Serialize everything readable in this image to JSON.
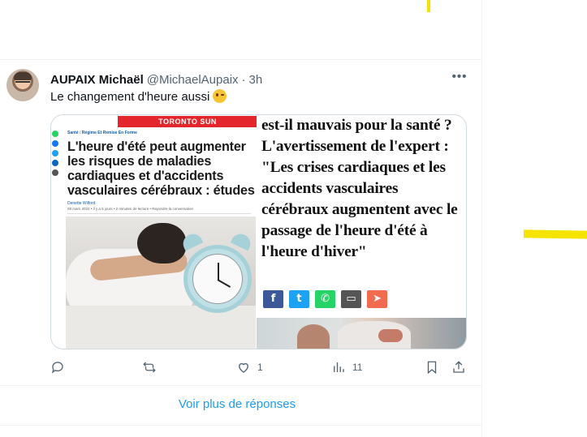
{
  "tweet": {
    "author_name": "AUPAIX Michaël",
    "handle": "@MichaelAupaix",
    "separator": "·",
    "time": "3h",
    "more_label": "•••",
    "text": "Le changement d'heure aussi",
    "emoji_icon": "winking-face-icon"
  },
  "media_left": {
    "masthead": "TORONTO SUN",
    "crumb_section": "Santé",
    "crumb_sub": "Régime Et Remise En Forme",
    "headline": "L'heure d'été peut augmenter les risques de maladies cardiaques et d'accidents vasculaires cérébraux : études",
    "author": "Denette Wilford",
    "meta": "08 mars 2022  •  il y a 5 jours  •  2 minutes de lecture  •  Rejoindre la conversation"
  },
  "media_right": {
    "text": "est-il mauvais pour la santé ? L'avertissement de l'expert : \"Les crises cardiaques et les accidents vasculaires cérébraux augmentent avec le passage de l'heure d'été à l'heure d'hiver\"",
    "share_buttons": [
      {
        "icon": "facebook-icon",
        "glyph": "f",
        "color": "#3b5998"
      },
      {
        "icon": "twitter-icon",
        "glyph": "t",
        "color": "#1da1f2"
      },
      {
        "icon": "whatsapp-icon",
        "glyph": "✆",
        "color": "#25d366"
      },
      {
        "icon": "comment-icon",
        "glyph": "▭",
        "color": "#555555"
      },
      {
        "icon": "telegram-icon",
        "glyph": "➤",
        "color": "#f26b4f"
      }
    ]
  },
  "actions": {
    "reply_count": "",
    "retweet_count": "",
    "like_count": "1",
    "views_count": "11"
  },
  "show_more_label": "Voir plus de réponses",
  "colors": {
    "accent": "#1d9bf0",
    "secondary_text": "#536471",
    "highlight_yellow": "#f5e400",
    "toronto_sun_red": "#e4262c"
  }
}
